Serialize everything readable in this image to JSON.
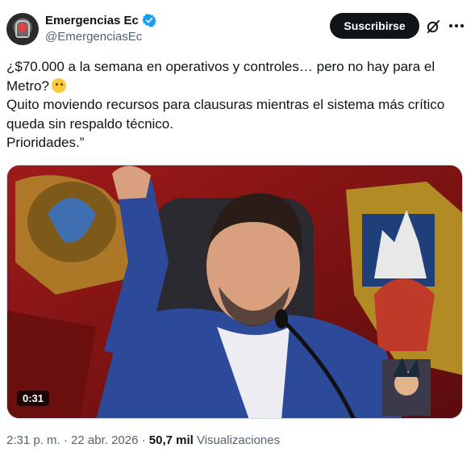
{
  "author": {
    "display_name": "Emergencias Ec",
    "handle": "@EmergenciasEc",
    "verified": true
  },
  "actions": {
    "subscribe_label": "Suscribirse",
    "grok_icon": "grok-icon",
    "more_icon": "more-icon"
  },
  "tweet": {
    "lines": [
      "¿$70.000 a la semana en operativos y controles… pero no hay para el",
      "Metro?",
      "Quito moviendo recursos para clausuras mientras el sistema más crítico",
      "queda sin respaldo técnico.",
      "Prioridades.”"
    ],
    "emoji": "raised-eyebrow-face"
  },
  "media": {
    "type": "video",
    "duration": "0:31"
  },
  "meta": {
    "time_date": "2:31 p. m. · 22 abr. 2026 · ",
    "views_count": "50,7 mil",
    "views_label": " Visualizaciones"
  },
  "colors": {
    "text": "#0f1419",
    "secondary": "#536471",
    "verified": "#1d9bf0",
    "button_bg": "#0f1419"
  }
}
